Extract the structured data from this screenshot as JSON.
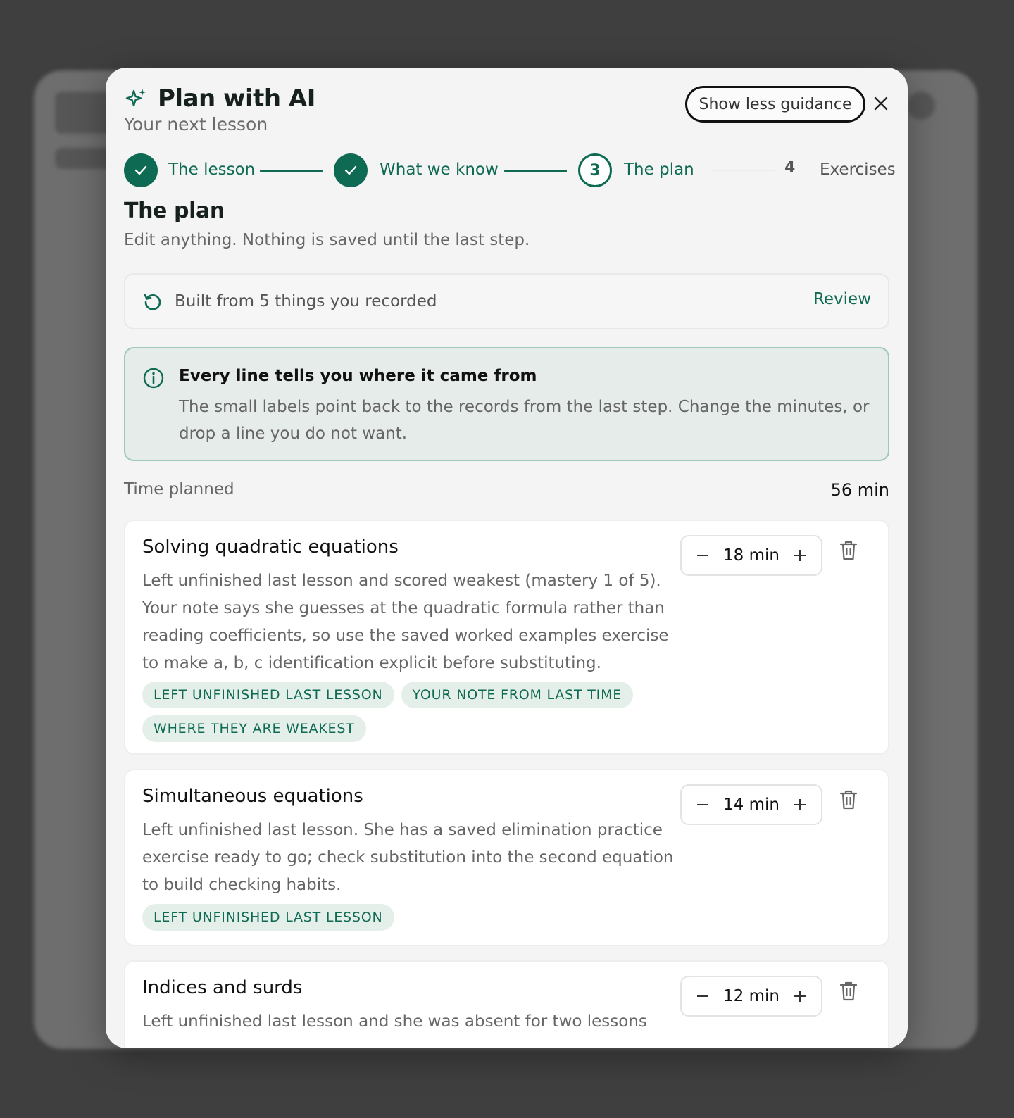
{
  "modal": {
    "title": "Plan with AI",
    "subtitle": "Your next lesson",
    "guidance_button": "Show less guidance",
    "close_icon": "close-icon",
    "title_icon": "sparkle-icon"
  },
  "stepper": {
    "steps": [
      {
        "label": "The lesson",
        "state": "done"
      },
      {
        "label": "What we know",
        "state": "done"
      },
      {
        "label": "The plan",
        "state": "current",
        "number": "3"
      },
      {
        "label": "Exercises",
        "state": "upcoming",
        "number": "4"
      }
    ]
  },
  "section": {
    "title": "The plan",
    "subtitle": "Edit anything. Nothing is saved until the last step."
  },
  "built_from": {
    "icon": "history-icon",
    "text": "Built from 5 things you recorded",
    "link": "Review"
  },
  "info": {
    "icon": "info-icon",
    "title": "Every line tells you where it came from",
    "body": "The small labels point back to the records from the last step. Change the minutes, or drop a line you do not want."
  },
  "time": {
    "label": "Time planned",
    "value": "56 min"
  },
  "plan_items": [
    {
      "title": "Solving quadratic equations",
      "body": "Left unfinished last lesson and scored weakest (mastery 1 of 5). Your note says she guesses at the quadratic formula rather than reading coefficients, so use the saved worked examples exercise to make a, b, c identification explicit before substituting.",
      "tags": [
        "LEFT UNFINISHED LAST LESSON",
        "YOUR NOTE FROM LAST TIME",
        "WHERE THEY ARE WEAKEST"
      ],
      "minutes": "18 min"
    },
    {
      "title": "Simultaneous equations",
      "body": "Left unfinished last lesson. She has a saved elimination practice exercise ready to go; check substitution into the second equation to build checking habits.",
      "tags": [
        "LEFT UNFINISHED LAST LESSON"
      ],
      "minutes": "14 min"
    },
    {
      "title": "Indices and surds",
      "body": "Left unfinished last lesson and she was absent for two lessons",
      "tags": [],
      "minutes": "12 min"
    }
  ],
  "colors": {
    "accent": "#0f6a53",
    "tag_bg": "#e4efea",
    "info_bg": "#e6ece9",
    "info_border": "#9cc9b9"
  }
}
